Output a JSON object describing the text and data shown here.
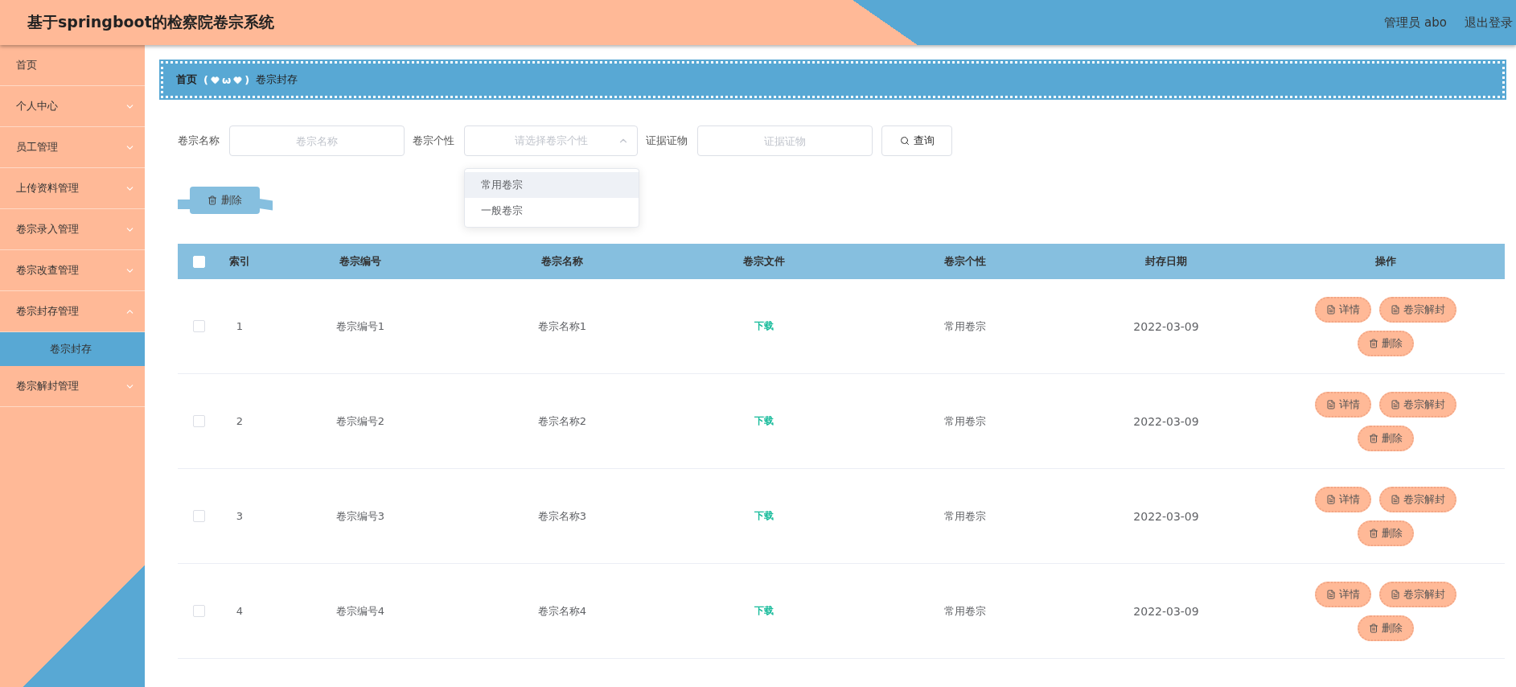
{
  "header": {
    "title": "基于springboot的检察院卷宗系统",
    "user": "管理员 abo",
    "logout": "退出登录"
  },
  "sidebar": {
    "items": [
      {
        "label": "首页",
        "has_children": false,
        "selected": false
      },
      {
        "label": "个人中心",
        "has_children": true,
        "expanded": false,
        "selected": false
      },
      {
        "label": "员工管理",
        "has_children": true,
        "expanded": false,
        "selected": false
      },
      {
        "label": "上传资料管理",
        "has_children": true,
        "expanded": false,
        "selected": false
      },
      {
        "label": "卷宗录入管理",
        "has_children": true,
        "expanded": false,
        "selected": false
      },
      {
        "label": "卷宗改查管理",
        "has_children": true,
        "expanded": false,
        "selected": false
      },
      {
        "label": "卷宗封存管理",
        "has_children": true,
        "expanded": true,
        "selected": false,
        "children": [
          {
            "label": "卷宗封存",
            "selected": true
          }
        ]
      },
      {
        "label": "卷宗解封管理",
        "has_children": true,
        "expanded": false,
        "selected": false
      }
    ]
  },
  "breadcrumb": {
    "items": [
      "首页",
      "卷宗封存"
    ],
    "separator": [
      "(",
      "ω",
      ")"
    ]
  },
  "search": {
    "fields": [
      {
        "kind": "input",
        "label": "卷宗名称",
        "placeholder": "卷宗名称"
      },
      {
        "kind": "select",
        "label": "卷宗个性",
        "placeholder": "请选择卷宗个性",
        "open": true,
        "options": [
          {
            "label": "常用卷宗",
            "highlighted": true
          },
          {
            "label": "一般卷宗",
            "highlighted": false
          }
        ]
      },
      {
        "kind": "input",
        "label": "证据证物",
        "placeholder": "证据证物"
      }
    ],
    "button": "查询"
  },
  "delete_button": "删除",
  "table": {
    "select_all_checked": false,
    "columns": [
      "索引",
      "卷宗编号",
      "卷宗名称",
      "卷宗文件",
      "卷宗个性",
      "封存日期",
      "操作"
    ],
    "rows": [
      {
        "checked": false,
        "index": "1",
        "number": "卷宗编号1",
        "name": "卷宗名称1",
        "file": "下载",
        "type": "常用卷宗",
        "date": "2022-03-09",
        "actions": [
          "详情",
          "卷宗解封",
          "删除"
        ]
      },
      {
        "checked": false,
        "index": "2",
        "number": "卷宗编号2",
        "name": "卷宗名称2",
        "file": "下载",
        "type": "常用卷宗",
        "date": "2022-03-09",
        "actions": [
          "详情",
          "卷宗解封",
          "删除"
        ]
      },
      {
        "checked": false,
        "index": "3",
        "number": "卷宗编号3",
        "name": "卷宗名称3",
        "file": "下载",
        "type": "常用卷宗",
        "date": "2022-03-09",
        "actions": [
          "详情",
          "卷宗解封",
          "删除"
        ]
      },
      {
        "checked": false,
        "index": "4",
        "number": "卷宗编号4",
        "name": "卷宗名称4",
        "file": "下载",
        "type": "常用卷宗",
        "date": "2022-03-09",
        "actions": [
          "详情",
          "卷宗解封",
          "删除"
        ]
      }
    ]
  }
}
